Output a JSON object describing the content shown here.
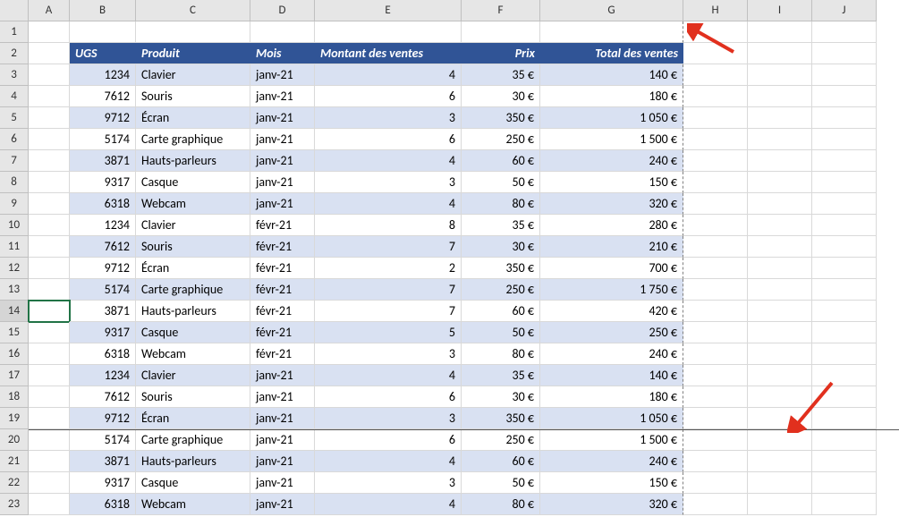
{
  "columns": [
    "A",
    "B",
    "C",
    "D",
    "E",
    "F",
    "G",
    "H",
    "I",
    "J"
  ],
  "row_numbers": [
    1,
    2,
    3,
    4,
    5,
    6,
    7,
    8,
    9,
    10,
    11,
    12,
    13,
    14,
    15,
    16,
    17,
    18,
    19,
    20,
    21,
    22,
    23
  ],
  "selected_row": 14,
  "table": {
    "headers": {
      "ugs": "UGS",
      "produit": "Produit",
      "mois": "Mois",
      "montant": "Montant des ventes",
      "prix": "Prix",
      "total": "Total des ventes"
    },
    "rows": [
      {
        "ugs": "1234",
        "produit": "Clavier",
        "mois": "janv-21",
        "montant": "4",
        "prix": "35 €",
        "total": "140 €"
      },
      {
        "ugs": "7612",
        "produit": "Souris",
        "mois": "janv-21",
        "montant": "6",
        "prix": "30 €",
        "total": "180 €"
      },
      {
        "ugs": "9712",
        "produit": "Écran",
        "mois": "janv-21",
        "montant": "3",
        "prix": "350 €",
        "total": "1 050 €"
      },
      {
        "ugs": "5174",
        "produit": "Carte graphique",
        "mois": "janv-21",
        "montant": "6",
        "prix": "250 €",
        "total": "1 500 €"
      },
      {
        "ugs": "3871",
        "produit": "Hauts-parleurs",
        "mois": "janv-21",
        "montant": "4",
        "prix": "60 €",
        "total": "240 €"
      },
      {
        "ugs": "9317",
        "produit": "Casque",
        "mois": "janv-21",
        "montant": "3",
        "prix": "50 €",
        "total": "150 €"
      },
      {
        "ugs": "6318",
        "produit": "Webcam",
        "mois": "janv-21",
        "montant": "4",
        "prix": "80 €",
        "total": "320 €"
      },
      {
        "ugs": "1234",
        "produit": "Clavier",
        "mois": "févr-21",
        "montant": "8",
        "prix": "35 €",
        "total": "280 €"
      },
      {
        "ugs": "7612",
        "produit": "Souris",
        "mois": "févr-21",
        "montant": "7",
        "prix": "30 €",
        "total": "210 €"
      },
      {
        "ugs": "9712",
        "produit": "Écran",
        "mois": "févr-21",
        "montant": "2",
        "prix": "350 €",
        "total": "700 €"
      },
      {
        "ugs": "5174",
        "produit": "Carte graphique",
        "mois": "févr-21",
        "montant": "7",
        "prix": "250 €",
        "total": "1 750 €"
      },
      {
        "ugs": "3871",
        "produit": "Hauts-parleurs",
        "mois": "févr-21",
        "montant": "7",
        "prix": "60 €",
        "total": "420 €"
      },
      {
        "ugs": "9317",
        "produit": "Casque",
        "mois": "févr-21",
        "montant": "5",
        "prix": "50 €",
        "total": "250 €"
      },
      {
        "ugs": "6318",
        "produit": "Webcam",
        "mois": "févr-21",
        "montant": "3",
        "prix": "80 €",
        "total": "240 €"
      },
      {
        "ugs": "1234",
        "produit": "Clavier",
        "mois": "janv-21",
        "montant": "4",
        "prix": "35 €",
        "total": "140 €"
      },
      {
        "ugs": "7612",
        "produit": "Souris",
        "mois": "janv-21",
        "montant": "6",
        "prix": "30 €",
        "total": "180 €"
      },
      {
        "ugs": "9712",
        "produit": "Écran",
        "mois": "janv-21",
        "montant": "3",
        "prix": "350 €",
        "total": "1 050 €"
      },
      {
        "ugs": "5174",
        "produit": "Carte graphique",
        "mois": "janv-21",
        "montant": "6",
        "prix": "250 €",
        "total": "1 500 €"
      },
      {
        "ugs": "3871",
        "produit": "Hauts-parleurs",
        "mois": "janv-21",
        "montant": "4",
        "prix": "60 €",
        "total": "240 €"
      },
      {
        "ugs": "9317",
        "produit": "Casque",
        "mois": "janv-21",
        "montant": "3",
        "prix": "50 €",
        "total": "150 €"
      },
      {
        "ugs": "6318",
        "produit": "Webcam",
        "mois": "janv-21",
        "montant": "4",
        "prix": "80 €",
        "total": "320 €"
      }
    ]
  }
}
